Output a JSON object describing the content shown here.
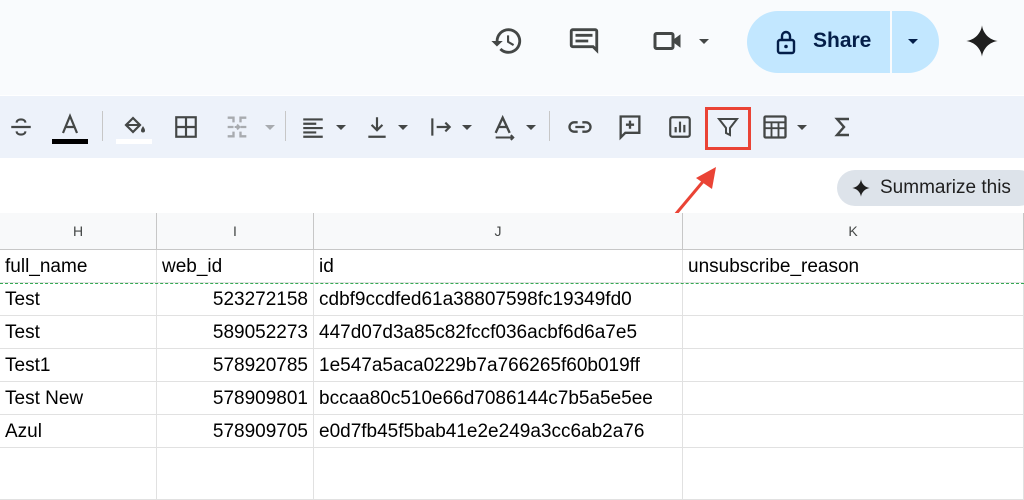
{
  "header": {
    "share_label": "Share",
    "icons": [
      "history-icon",
      "comment-icon",
      "video-call-icon",
      "lock-icon",
      "gemini-sparkle-icon"
    ]
  },
  "toolbar": {
    "icons": [
      "strikethrough-icon",
      "text-color-icon",
      "fill-color-icon",
      "borders-icon",
      "merge-cells-icon",
      "horizontal-align-icon",
      "vertical-align-icon",
      "text-wrap-icon",
      "text-rotation-icon",
      "insert-link-icon",
      "insert-comment-icon",
      "insert-chart-icon",
      "create-filter-icon",
      "filter-views-icon",
      "functions-icon"
    ],
    "text_color": "#000000",
    "fill_color": "#ffffff",
    "highlight_color": "#ea4335"
  },
  "summarize": {
    "label": "Summarize this"
  },
  "grid": {
    "columns": [
      "H",
      "I",
      "J",
      "K"
    ],
    "header_row": [
      "full_name",
      "web_id",
      "id",
      "unsubscribe_reason"
    ],
    "rows": [
      [
        "Test",
        "523272158",
        "cdbf9ccdfed61a38807598fc19349fd0",
        ""
      ],
      [
        "Test",
        "589052273",
        "447d07d3a85c82fccf036acbf6d6a7e5",
        ""
      ],
      [
        "Test1",
        "578920785",
        "1e547a5aca0229b7a766265f60b019ff",
        ""
      ],
      [
        "Test New",
        "578909801",
        "bccaa80c510e66d7086144c7b5a5e5ee",
        ""
      ],
      [
        "Azul",
        "578909705",
        "e0d7fb45f5bab41e2e249a3cc6ab2a76",
        ""
      ]
    ]
  }
}
